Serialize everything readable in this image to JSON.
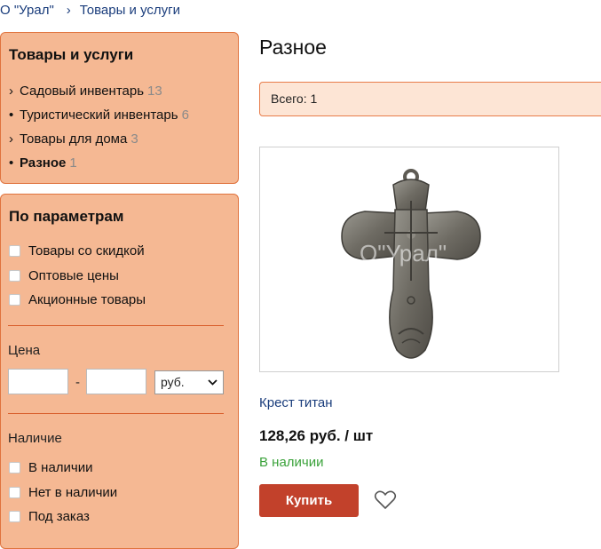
{
  "breadcrumb": {
    "items": [
      "О \"Урал\"",
      "Товары и услуги"
    ],
    "separator": "›"
  },
  "sidebar": {
    "categories_title": "Товары и услуги",
    "categories": [
      {
        "bullet": "›",
        "label": "Садовый инвентарь",
        "count": "13"
      },
      {
        "bullet": "•",
        "label": "Туристический инвентарь",
        "count": "6"
      },
      {
        "bullet": "›",
        "label": "Товары для дома",
        "count": "3"
      },
      {
        "bullet": "•",
        "label": "Разное",
        "count": "1",
        "active": true
      }
    ],
    "params_title": "По параметрам",
    "param_checkboxes": [
      "Товары со скидкой",
      "Оптовые цены",
      "Акционные товары"
    ],
    "price_label": "Цена",
    "price_dash": "-",
    "price_from": "",
    "price_to": "",
    "currency": "руб.",
    "availability_label": "Наличие",
    "availability_checkboxes": [
      "В наличии",
      "Нет в наличии",
      "Под заказ"
    ]
  },
  "main": {
    "title": "Разное",
    "total_text": "Всего: 1"
  },
  "product": {
    "name": "Крест титан",
    "price": "128,26 руб. / шт",
    "stock": "В наличии",
    "buy_label": "Купить",
    "watermark": "О\"Урал\""
  },
  "colors": {
    "panel_bg": "#f5b893",
    "panel_border": "#e0733e",
    "buy_button": "#c2412b",
    "stock_green": "#3aa23a",
    "link_blue": "#1a3d7c"
  },
  "icons": {
    "wishlist": "heart-icon",
    "dropdown": "chevron-down-icon"
  }
}
